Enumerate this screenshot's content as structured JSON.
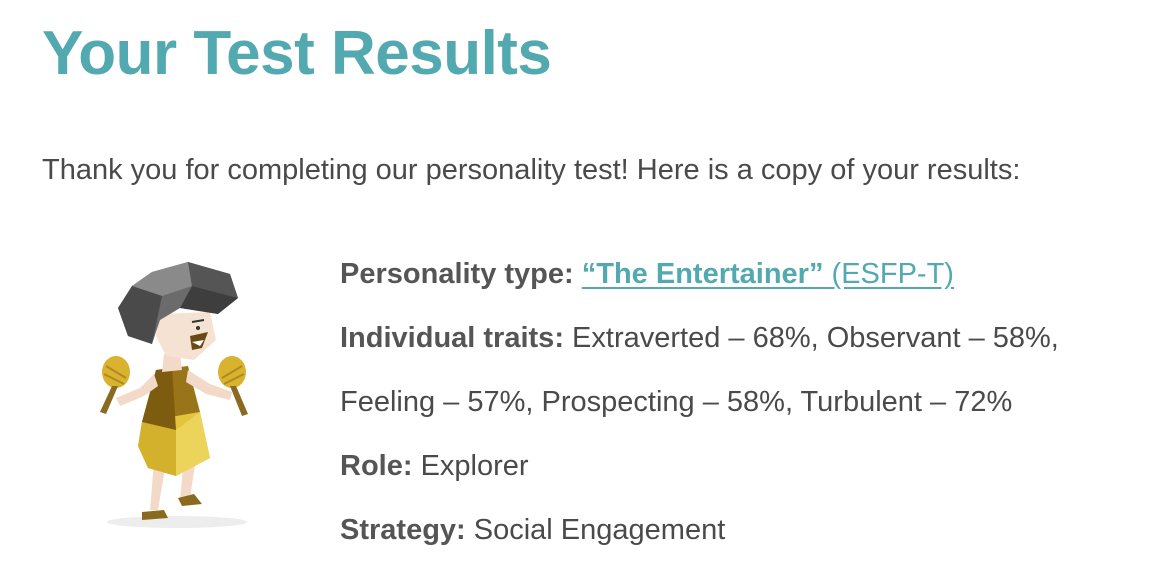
{
  "header": {
    "title": "Your Test Results"
  },
  "intro": {
    "text": "Thank you for completing our personality test! Here is a copy of your results:"
  },
  "illustration": {
    "icon": "entertainer-character-with-maracas"
  },
  "results": {
    "personality_type": {
      "label": "Personality type:",
      "name": "“The Entertainer”",
      "code": "(ESFP-T)"
    },
    "traits": {
      "label": "Individual traits:",
      "line1": "Extraverted – 68%, Observant – 58%,",
      "line2": "Feeling – 57%, Prospecting – 58%, Turbulent – 72%"
    },
    "role": {
      "label": "Role:",
      "value": "Explorer"
    },
    "strategy": {
      "label": "Strategy:",
      "value": "Social Engagement"
    }
  },
  "colors": {
    "accent": "#52a9b0",
    "text": "#4a4a4a"
  }
}
